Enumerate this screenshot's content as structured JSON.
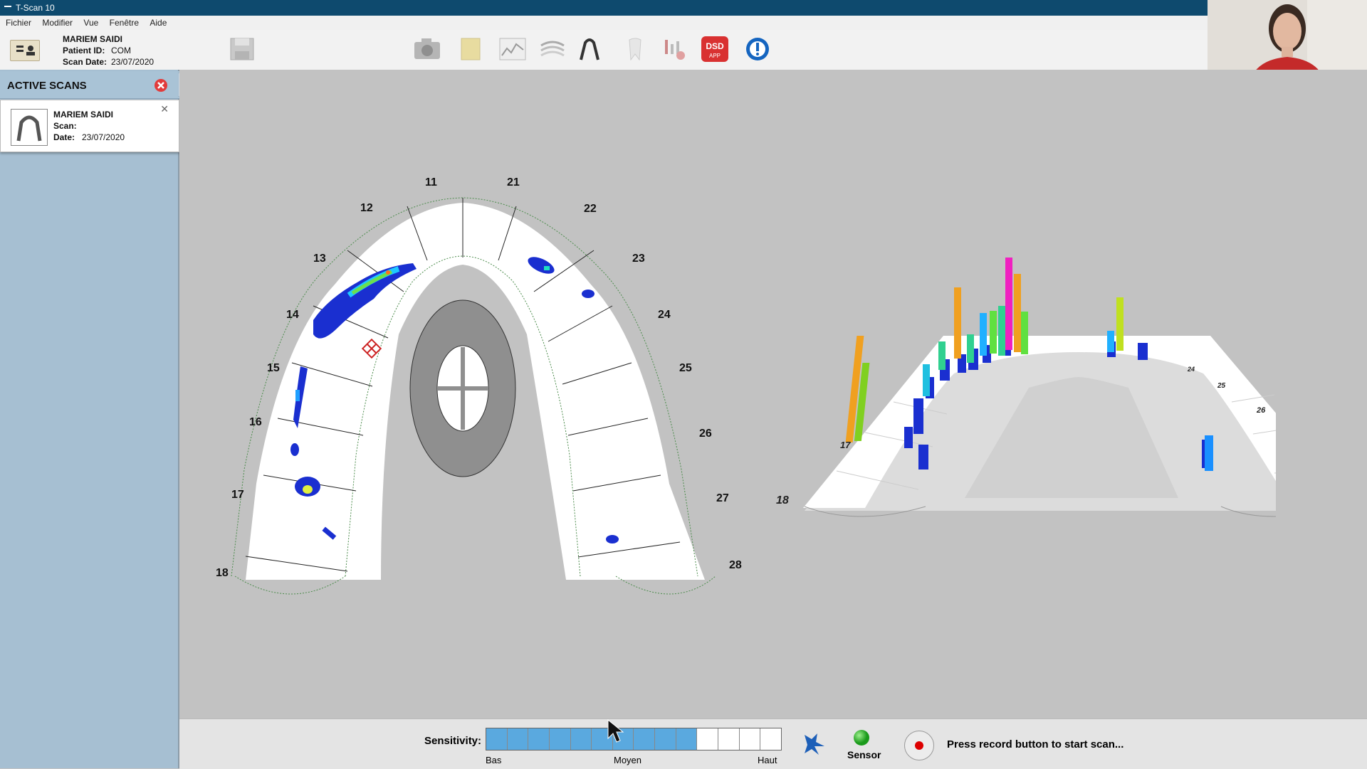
{
  "window": {
    "title": "T-Scan 10"
  },
  "menu": [
    "Fichier",
    "Modifier",
    "Vue",
    "Fenêtre",
    "Aide"
  ],
  "patient": {
    "name": "MARIEM SAIDI",
    "id_label": "Patient ID:",
    "id_value": "COM",
    "date_label": "Scan Date:",
    "date_value": "23/07/2020"
  },
  "toolbar_icons": [
    "patient-icon",
    "save-icon",
    "camera-icon",
    "notes-icon",
    "graph-icon",
    "layers-icon",
    "arch-icon",
    "tooth-icon",
    "balance-icon",
    "dsd-app-icon",
    "help-icon"
  ],
  "dsd_label": "DSD",
  "dsd_sub": "APP",
  "active_scans": {
    "title": "ACTIVE SCANS",
    "card": {
      "name": "MARIEM SAIDI",
      "scan_label": "Scan:",
      "scan_value": "",
      "date_label": "Date:",
      "date_value": "23/07/2020"
    }
  },
  "teeth_left": [
    "18",
    "17",
    "16",
    "15",
    "14",
    "13",
    "12",
    "11"
  ],
  "teeth_right": [
    "21",
    "22",
    "23",
    "24",
    "25",
    "26",
    "27",
    "28"
  ],
  "bottom": {
    "sensitivity_label": "Sensitivity:",
    "sensitivity_filled": 10,
    "sensitivity_total": 14,
    "low": "Bas",
    "mid": "Moyen",
    "high": "Haut",
    "sensor_label": "Sensor",
    "status_text": "Press record button to start scan..."
  },
  "colors": {
    "accent": "#0e4a6e",
    "filled": "#5aa9df",
    "sidebar": "#a6bfd2"
  }
}
